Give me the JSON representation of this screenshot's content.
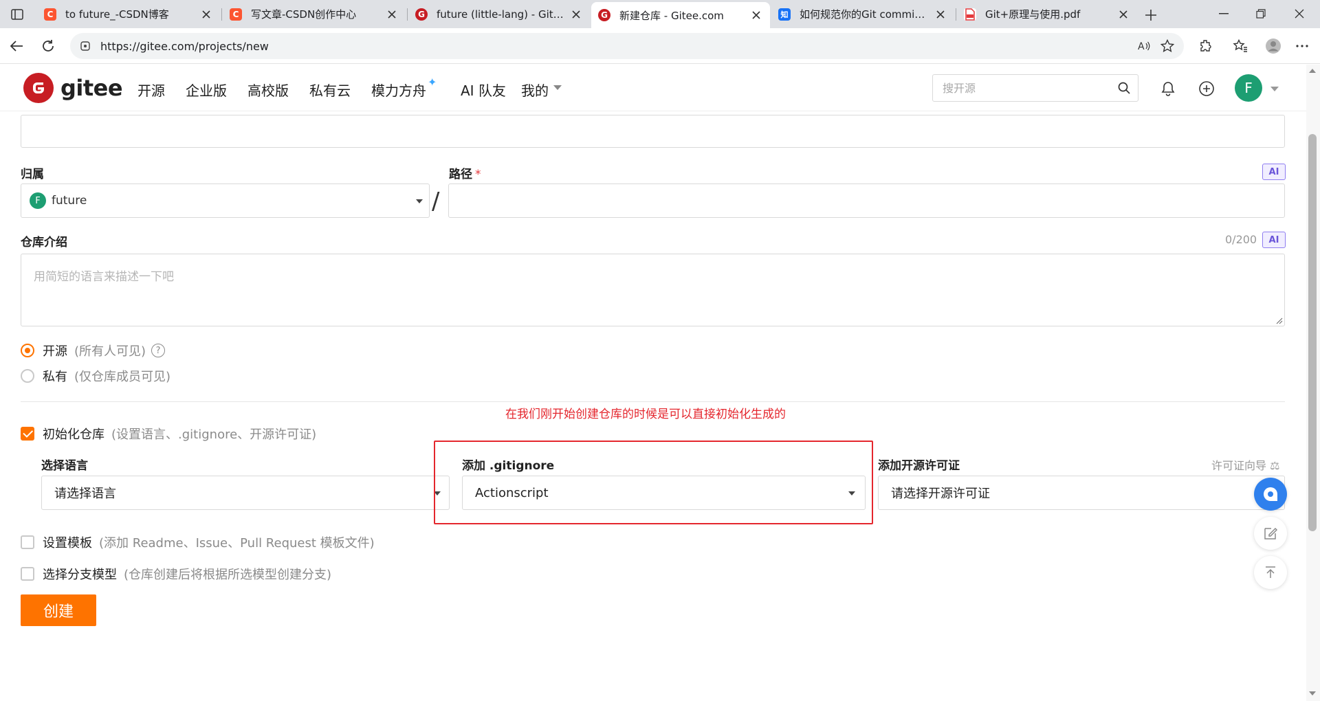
{
  "browser": {
    "tabs": [
      {
        "title": "to future_-CSDN博客",
        "icon": "csdn-icon",
        "fav_letter": "C",
        "color": "#fc5531"
      },
      {
        "title": "写文章-CSDN创作中心",
        "icon": "csdn-icon",
        "fav_letter": "C",
        "color": "#fc5531"
      },
      {
        "title": "future (little-lang) - Gitee.com",
        "icon": "gitee-icon",
        "fav_letter": "G",
        "color": "#c71d23"
      },
      {
        "title": "新建仓库 - Gitee.com",
        "icon": "gitee-icon",
        "fav_letter": "G",
        "color": "#c71d23"
      },
      {
        "title": "如何规范你的Git commit? - 知乎",
        "icon": "zhihu-icon",
        "fav_letter": "知",
        "color": "#1772f6"
      },
      {
        "title": "Git+原理与使用.pdf",
        "icon": "pdf-icon",
        "fav_letter": "",
        "color": "#e4393c"
      }
    ],
    "active_tab": 3,
    "url": "https://gitee.com/projects/new"
  },
  "header": {
    "brand": "gitee",
    "nav": [
      "开源",
      "企业版",
      "高校版",
      "私有云",
      "模力方舟",
      "AI 队友",
      "我的"
    ],
    "search_placeholder": "搜开源",
    "user_initial": "F",
    "brand_color": "#c71d23"
  },
  "form": {
    "owner_label": "归属",
    "owner_value": "future",
    "owner_initial": "F",
    "path_label": "路径",
    "path_required": "*",
    "ai_badge": "AI",
    "slash": "/",
    "desc_label": "仓库介绍",
    "desc_counter": "0/200",
    "desc_placeholder": "用简短的语言来描述一下吧",
    "visibility": [
      {
        "label": "开源",
        "hint": "(所有人可见)",
        "selected": true,
        "help": "?"
      },
      {
        "label": "私有",
        "hint": "(仅仓库成员可见)",
        "selected": false
      }
    ],
    "annotation": "在我们刚开始创建仓库的时候是可以直接初始化生成的",
    "init": {
      "label": "初始化仓库",
      "hint": "(设置语言、.gitignore、开源许可证)",
      "checked": true
    },
    "language": {
      "label": "选择语言",
      "value": "请选择语言"
    },
    "gitignore": {
      "label": "添加 .gitignore",
      "value": "Actionscript"
    },
    "license": {
      "label": "添加开源许可证",
      "value": "请选择开源许可证",
      "guide": "许可证向导"
    },
    "template": {
      "label": "设置模板",
      "hint": "(添加 Readme、Issue、Pull Request 模板文件)",
      "checked": false
    },
    "branch": {
      "label": "选择分支模型",
      "hint": "(仓库创建后将根据所选模型创建分支)",
      "checked": false
    },
    "submit_label": "创建",
    "accent_color": "#fe7300"
  }
}
